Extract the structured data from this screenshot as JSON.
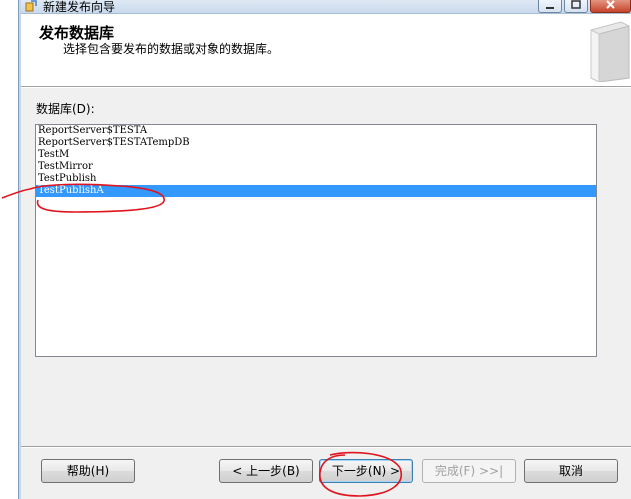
{
  "window": {
    "title": "新建发布向导"
  },
  "header": {
    "title": "发布数据库",
    "subtitle": "选择包含要发布的数据或对象的数据库。"
  },
  "databases": {
    "label": "数据库(D):",
    "items": [
      "ReportServer$TESTA",
      "ReportServer$TESTATempDB",
      "TestM",
      "TestMirror",
      "TestPublish",
      "TestPublishA"
    ],
    "selected": "TestPublishA"
  },
  "footer": {
    "help_label": "帮助(H)",
    "back_label": "< 上一步(B)",
    "next_label": "下一步(N) >",
    "finish_label": "完成(F) >>|",
    "cancel_label": "取消"
  },
  "colors": {
    "selection": "#3399ff",
    "annotation": "#e0141e"
  }
}
